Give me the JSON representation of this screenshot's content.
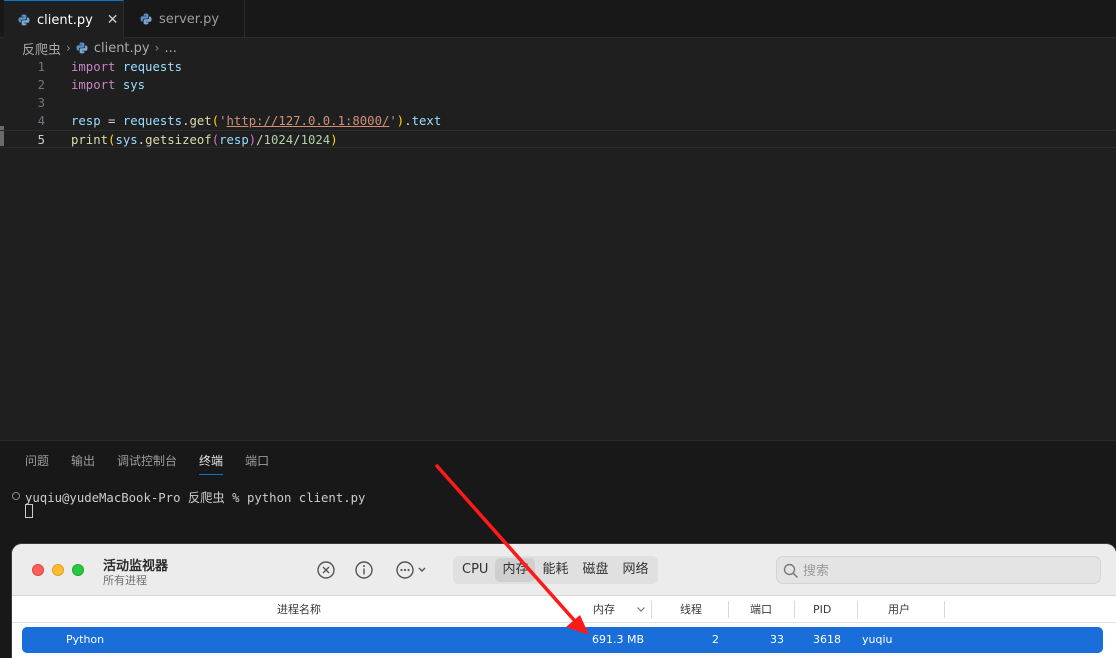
{
  "editor": {
    "tabs": [
      {
        "label": "client.py",
        "active": true
      },
      {
        "label": "server.py",
        "active": false
      }
    ],
    "close_glyph": "✕",
    "breadcrumb": {
      "folder": "反爬虫",
      "file": "client.py",
      "more": "..."
    },
    "lines": [
      {
        "number": "1",
        "tokens": [
          {
            "text": "import",
            "class": "kw"
          },
          {
            "text": " ",
            "class": ""
          },
          {
            "text": "requests",
            "class": "var"
          }
        ]
      },
      {
        "number": "2",
        "tokens": [
          {
            "text": "import",
            "class": "kw"
          },
          {
            "text": " ",
            "class": ""
          },
          {
            "text": "sys",
            "class": "var"
          }
        ]
      },
      {
        "number": "3",
        "tokens": []
      },
      {
        "number": "4",
        "tokens": [
          {
            "text": "resp",
            "class": "var"
          },
          {
            "text": " = ",
            "class": "op"
          },
          {
            "text": "requests",
            "class": "var"
          },
          {
            "text": ".",
            "class": "op"
          },
          {
            "text": "get",
            "class": "fn"
          },
          {
            "text": "(",
            "class": "br1"
          },
          {
            "text": "'",
            "class": "str"
          },
          {
            "text": "http://127.0.0.1:8000/",
            "class": "str url"
          },
          {
            "text": "'",
            "class": "str"
          },
          {
            "text": ")",
            "class": "br1"
          },
          {
            "text": ".",
            "class": "op"
          },
          {
            "text": "text",
            "class": "var"
          }
        ]
      },
      {
        "number": "5",
        "current": true,
        "tokens": [
          {
            "text": "print",
            "class": "fn"
          },
          {
            "text": "(",
            "class": "br1"
          },
          {
            "text": "sys",
            "class": "var"
          },
          {
            "text": ".",
            "class": "op"
          },
          {
            "text": "getsizeof",
            "class": "fn"
          },
          {
            "text": "(",
            "class": "br2"
          },
          {
            "text": "resp",
            "class": "var"
          },
          {
            "text": ")",
            "class": "br2"
          },
          {
            "text": "/",
            "class": "op"
          },
          {
            "text": "1024",
            "class": "num"
          },
          {
            "text": "/",
            "class": "op"
          },
          {
            "text": "1024",
            "class": "num"
          },
          {
            "text": ")",
            "class": "br1"
          }
        ]
      }
    ]
  },
  "panel": {
    "tabs": [
      "问题",
      "输出",
      "调试控制台",
      "终端",
      "端口"
    ],
    "active_tab": "终端",
    "terminal_command": "yuqiu@yudeMacBook-Pro 反爬虫 % python client.py"
  },
  "activity_monitor": {
    "title": "活动监视器",
    "subtitle": "所有进程",
    "segments": [
      "CPU",
      "内存",
      "能耗",
      "磁盘",
      "网络"
    ],
    "active_segment": "内存",
    "search_placeholder": "搜索",
    "columns": {
      "name": "进程名称",
      "memory": "内存",
      "threads": "线程",
      "ports": "端口",
      "pid": "PID",
      "user": "用户"
    },
    "row": {
      "name": "Python",
      "memory": "691.3 MB",
      "threads": "2",
      "ports": "33",
      "pid": "3618",
      "user": "yuqiu"
    }
  },
  "colors": {
    "accent": "#0078d4",
    "selection": "#1a6ed9",
    "arrow": "#ff1a1a"
  }
}
